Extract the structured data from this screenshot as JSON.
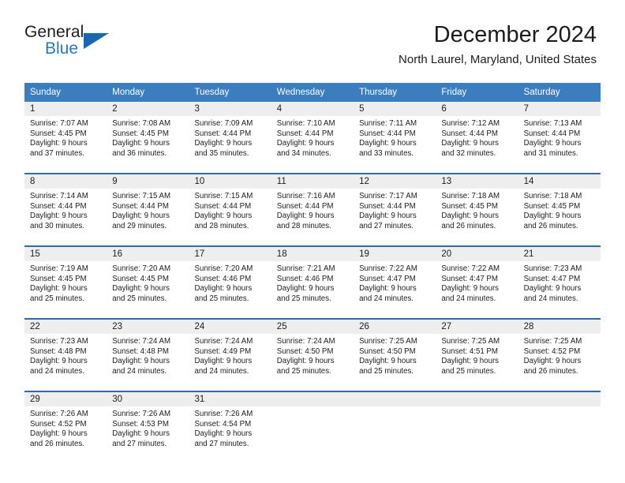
{
  "brand": {
    "name_top": "General",
    "name_bottom": "Blue",
    "accent_color": "#1f7ac4",
    "triangle_color": "#1668b0"
  },
  "header": {
    "title": "December 2024",
    "subtitle": "North Laurel, Maryland, United States"
  },
  "theme": {
    "header_bg": "#3a7ebf",
    "header_text": "#ffffff",
    "row_border": "#2b6ba8",
    "day_band_bg": "#eeeeee",
    "text": "#1c1c1c"
  },
  "weekdays": [
    "Sunday",
    "Monday",
    "Tuesday",
    "Wednesday",
    "Thursday",
    "Friday",
    "Saturday"
  ],
  "weeks": [
    {
      "days": [
        {
          "num": "1",
          "sunrise": "Sunrise: 7:07 AM",
          "sunset": "Sunset: 4:45 PM",
          "daylight_1": "Daylight: 9 hours",
          "daylight_2": "and 37 minutes."
        },
        {
          "num": "2",
          "sunrise": "Sunrise: 7:08 AM",
          "sunset": "Sunset: 4:45 PM",
          "daylight_1": "Daylight: 9 hours",
          "daylight_2": "and 36 minutes."
        },
        {
          "num": "3",
          "sunrise": "Sunrise: 7:09 AM",
          "sunset": "Sunset: 4:44 PM",
          "daylight_1": "Daylight: 9 hours",
          "daylight_2": "and 35 minutes."
        },
        {
          "num": "4",
          "sunrise": "Sunrise: 7:10 AM",
          "sunset": "Sunset: 4:44 PM",
          "daylight_1": "Daylight: 9 hours",
          "daylight_2": "and 34 minutes."
        },
        {
          "num": "5",
          "sunrise": "Sunrise: 7:11 AM",
          "sunset": "Sunset: 4:44 PM",
          "daylight_1": "Daylight: 9 hours",
          "daylight_2": "and 33 minutes."
        },
        {
          "num": "6",
          "sunrise": "Sunrise: 7:12 AM",
          "sunset": "Sunset: 4:44 PM",
          "daylight_1": "Daylight: 9 hours",
          "daylight_2": "and 32 minutes."
        },
        {
          "num": "7",
          "sunrise": "Sunrise: 7:13 AM",
          "sunset": "Sunset: 4:44 PM",
          "daylight_1": "Daylight: 9 hours",
          "daylight_2": "and 31 minutes."
        }
      ]
    },
    {
      "days": [
        {
          "num": "8",
          "sunrise": "Sunrise: 7:14 AM",
          "sunset": "Sunset: 4:44 PM",
          "daylight_1": "Daylight: 9 hours",
          "daylight_2": "and 30 minutes."
        },
        {
          "num": "9",
          "sunrise": "Sunrise: 7:15 AM",
          "sunset": "Sunset: 4:44 PM",
          "daylight_1": "Daylight: 9 hours",
          "daylight_2": "and 29 minutes."
        },
        {
          "num": "10",
          "sunrise": "Sunrise: 7:15 AM",
          "sunset": "Sunset: 4:44 PM",
          "daylight_1": "Daylight: 9 hours",
          "daylight_2": "and 28 minutes."
        },
        {
          "num": "11",
          "sunrise": "Sunrise: 7:16 AM",
          "sunset": "Sunset: 4:44 PM",
          "daylight_1": "Daylight: 9 hours",
          "daylight_2": "and 28 minutes."
        },
        {
          "num": "12",
          "sunrise": "Sunrise: 7:17 AM",
          "sunset": "Sunset: 4:44 PM",
          "daylight_1": "Daylight: 9 hours",
          "daylight_2": "and 27 minutes."
        },
        {
          "num": "13",
          "sunrise": "Sunrise: 7:18 AM",
          "sunset": "Sunset: 4:45 PM",
          "daylight_1": "Daylight: 9 hours",
          "daylight_2": "and 26 minutes."
        },
        {
          "num": "14",
          "sunrise": "Sunrise: 7:18 AM",
          "sunset": "Sunset: 4:45 PM",
          "daylight_1": "Daylight: 9 hours",
          "daylight_2": "and 26 minutes."
        }
      ]
    },
    {
      "days": [
        {
          "num": "15",
          "sunrise": "Sunrise: 7:19 AM",
          "sunset": "Sunset: 4:45 PM",
          "daylight_1": "Daylight: 9 hours",
          "daylight_2": "and 25 minutes."
        },
        {
          "num": "16",
          "sunrise": "Sunrise: 7:20 AM",
          "sunset": "Sunset: 4:45 PM",
          "daylight_1": "Daylight: 9 hours",
          "daylight_2": "and 25 minutes."
        },
        {
          "num": "17",
          "sunrise": "Sunrise: 7:20 AM",
          "sunset": "Sunset: 4:46 PM",
          "daylight_1": "Daylight: 9 hours",
          "daylight_2": "and 25 minutes."
        },
        {
          "num": "18",
          "sunrise": "Sunrise: 7:21 AM",
          "sunset": "Sunset: 4:46 PM",
          "daylight_1": "Daylight: 9 hours",
          "daylight_2": "and 25 minutes."
        },
        {
          "num": "19",
          "sunrise": "Sunrise: 7:22 AM",
          "sunset": "Sunset: 4:47 PM",
          "daylight_1": "Daylight: 9 hours",
          "daylight_2": "and 24 minutes."
        },
        {
          "num": "20",
          "sunrise": "Sunrise: 7:22 AM",
          "sunset": "Sunset: 4:47 PM",
          "daylight_1": "Daylight: 9 hours",
          "daylight_2": "and 24 minutes."
        },
        {
          "num": "21",
          "sunrise": "Sunrise: 7:23 AM",
          "sunset": "Sunset: 4:47 PM",
          "daylight_1": "Daylight: 9 hours",
          "daylight_2": "and 24 minutes."
        }
      ]
    },
    {
      "days": [
        {
          "num": "22",
          "sunrise": "Sunrise: 7:23 AM",
          "sunset": "Sunset: 4:48 PM",
          "daylight_1": "Daylight: 9 hours",
          "daylight_2": "and 24 minutes."
        },
        {
          "num": "23",
          "sunrise": "Sunrise: 7:24 AM",
          "sunset": "Sunset: 4:48 PM",
          "daylight_1": "Daylight: 9 hours",
          "daylight_2": "and 24 minutes."
        },
        {
          "num": "24",
          "sunrise": "Sunrise: 7:24 AM",
          "sunset": "Sunset: 4:49 PM",
          "daylight_1": "Daylight: 9 hours",
          "daylight_2": "and 24 minutes."
        },
        {
          "num": "25",
          "sunrise": "Sunrise: 7:24 AM",
          "sunset": "Sunset: 4:50 PM",
          "daylight_1": "Daylight: 9 hours",
          "daylight_2": "and 25 minutes."
        },
        {
          "num": "26",
          "sunrise": "Sunrise: 7:25 AM",
          "sunset": "Sunset: 4:50 PM",
          "daylight_1": "Daylight: 9 hours",
          "daylight_2": "and 25 minutes."
        },
        {
          "num": "27",
          "sunrise": "Sunrise: 7:25 AM",
          "sunset": "Sunset: 4:51 PM",
          "daylight_1": "Daylight: 9 hours",
          "daylight_2": "and 25 minutes."
        },
        {
          "num": "28",
          "sunrise": "Sunrise: 7:25 AM",
          "sunset": "Sunset: 4:52 PM",
          "daylight_1": "Daylight: 9 hours",
          "daylight_2": "and 26 minutes."
        }
      ]
    },
    {
      "days": [
        {
          "num": "29",
          "sunrise": "Sunrise: 7:26 AM",
          "sunset": "Sunset: 4:52 PM",
          "daylight_1": "Daylight: 9 hours",
          "daylight_2": "and 26 minutes."
        },
        {
          "num": "30",
          "sunrise": "Sunrise: 7:26 AM",
          "sunset": "Sunset: 4:53 PM",
          "daylight_1": "Daylight: 9 hours",
          "daylight_2": "and 27 minutes."
        },
        {
          "num": "31",
          "sunrise": "Sunrise: 7:26 AM",
          "sunset": "Sunset: 4:54 PM",
          "daylight_1": "Daylight: 9 hours",
          "daylight_2": "and 27 minutes."
        },
        {
          "num": "",
          "sunrise": "",
          "sunset": "",
          "daylight_1": "",
          "daylight_2": ""
        },
        {
          "num": "",
          "sunrise": "",
          "sunset": "",
          "daylight_1": "",
          "daylight_2": ""
        },
        {
          "num": "",
          "sunrise": "",
          "sunset": "",
          "daylight_1": "",
          "daylight_2": ""
        },
        {
          "num": "",
          "sunrise": "",
          "sunset": "",
          "daylight_1": "",
          "daylight_2": ""
        }
      ]
    }
  ]
}
